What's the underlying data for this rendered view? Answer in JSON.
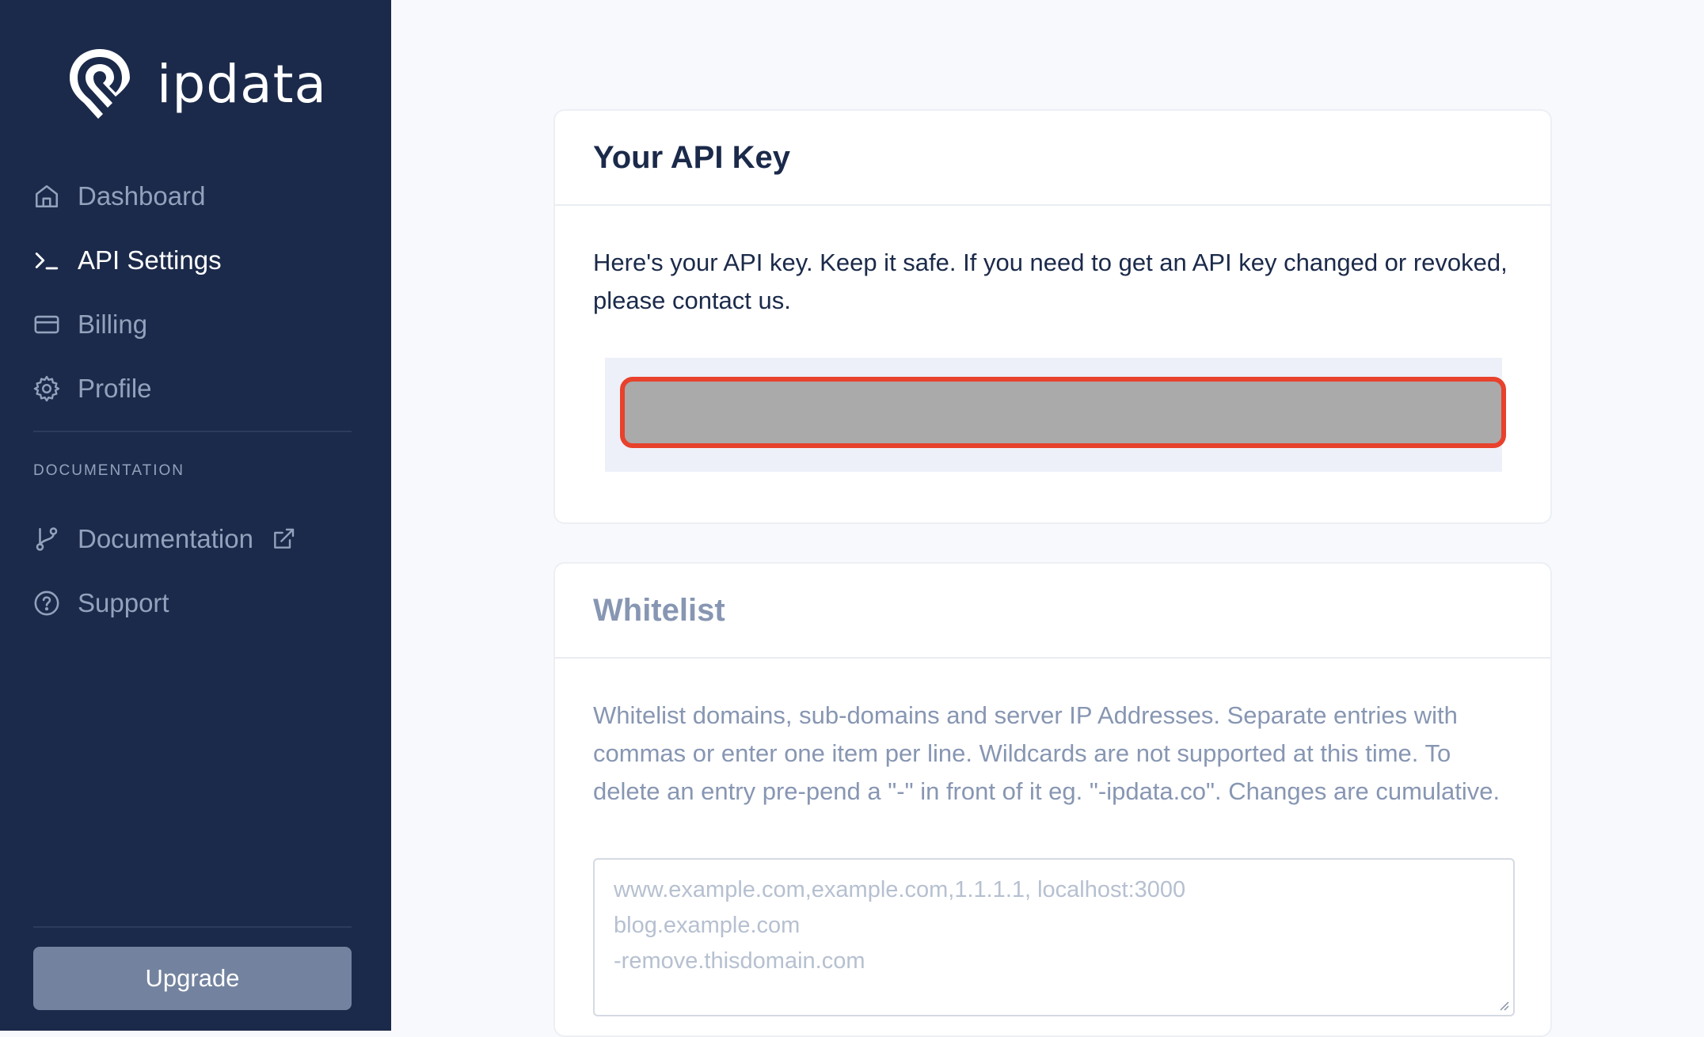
{
  "brand": {
    "name": "ipdata"
  },
  "sidebar": {
    "nav_items": [
      {
        "label": "Dashboard",
        "icon": "home-icon",
        "active": false
      },
      {
        "label": "API Settings",
        "icon": "terminal-icon",
        "active": true
      },
      {
        "label": "Billing",
        "icon": "credit-card-icon",
        "active": false
      },
      {
        "label": "Profile",
        "icon": "gear-icon",
        "active": false
      }
    ],
    "section_title": "DOCUMENTATION",
    "doc_items": [
      {
        "label": "Documentation",
        "icon": "git-branch-icon",
        "trailing_icon": "external-link-icon"
      },
      {
        "label": "Support",
        "icon": "help-circle-icon"
      }
    ],
    "upgrade_label": "Upgrade"
  },
  "api_key_card": {
    "title": "Your API Key",
    "description": "Here's your API key. Keep it safe. If you need to get an API key changed or revoked, please contact us."
  },
  "whitelist_card": {
    "title": "Whitelist",
    "description": "Whitelist domains, sub-domains and server IP Addresses. Separate entries with commas or enter one item per line. Wildcards are not supported at this time. To delete an entry pre-pend a \"-\" in front of it eg. \"-ipdata.co\". Changes are cumulative.",
    "placeholder_lines": [
      "www.example.com,example.com,1.1.1.1, localhost:3000",
      "blog.example.com",
      "-remove.thisdomain.com"
    ]
  },
  "colors": {
    "sidebar_bg": "#1b2a4a",
    "highlight_border": "#e8412c",
    "upgrade_bg": "#73839f"
  }
}
